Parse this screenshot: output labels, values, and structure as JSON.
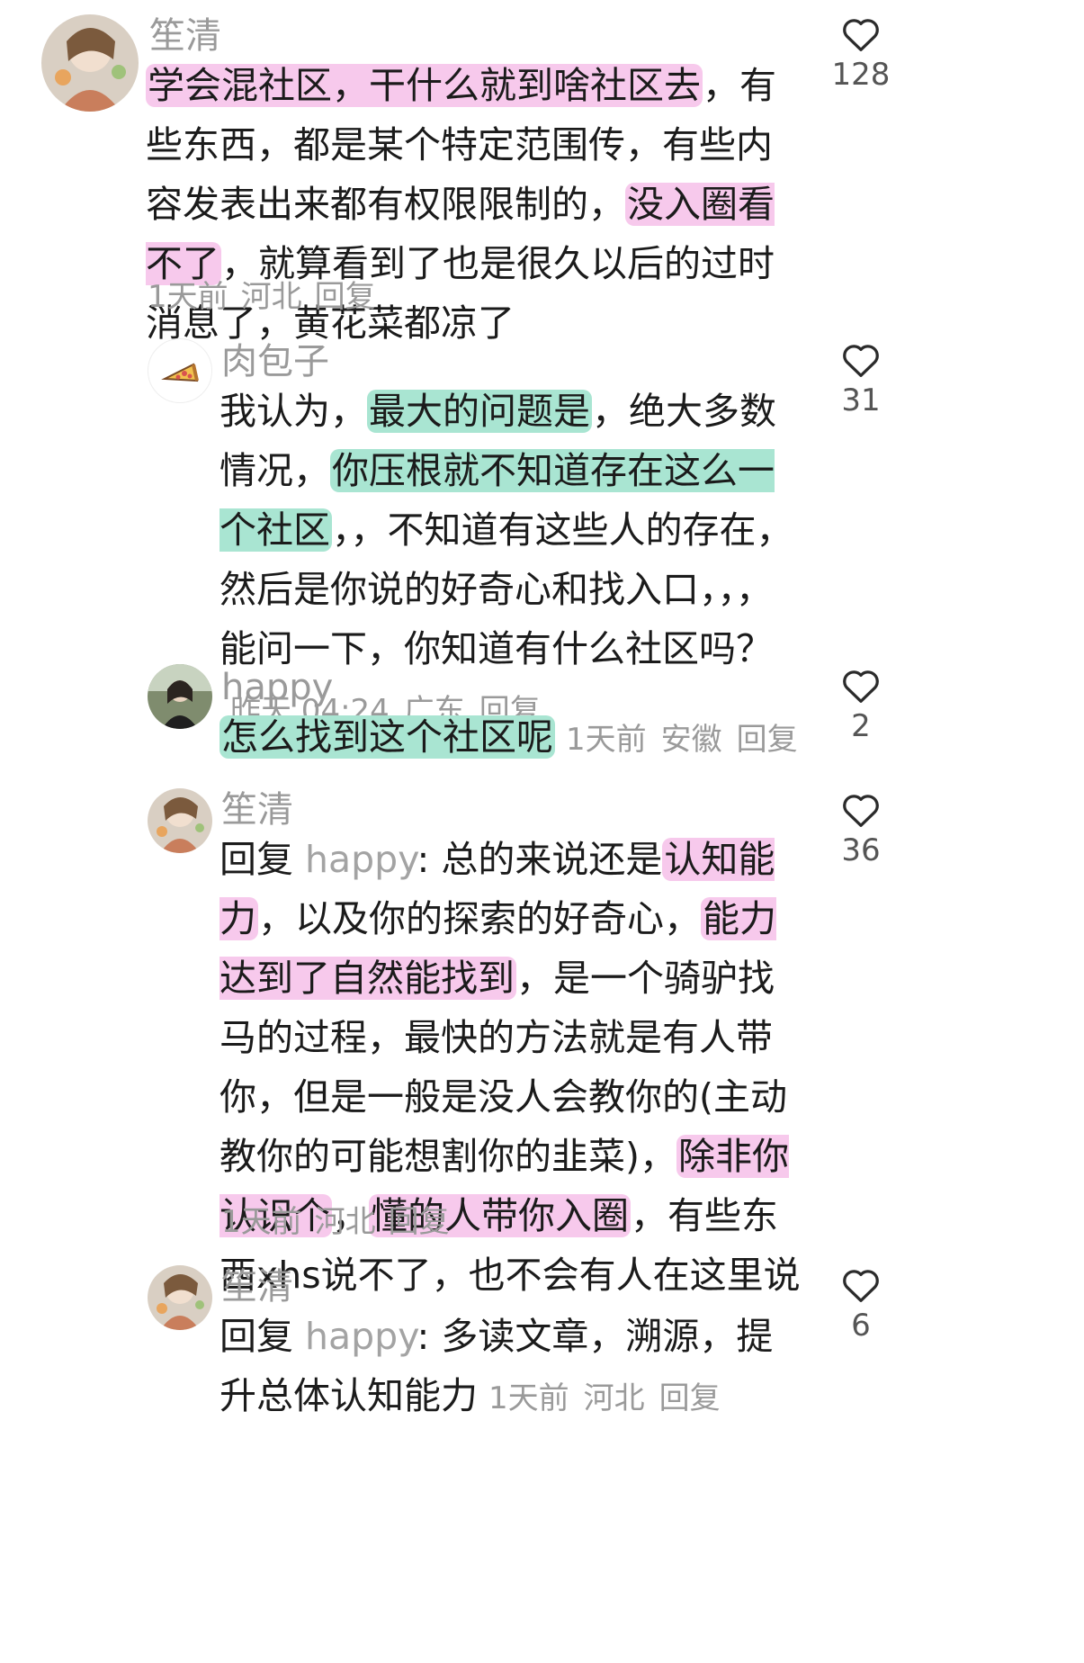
{
  "comments": [
    {
      "username": "笙清",
      "segments": [
        {
          "t": "学会混社区，干什么就到啥社区去",
          "hl": "pink"
        },
        {
          "t": "，有些东西，都是某个特定范围传，有些内容发表出来都有权限限制的，"
        },
        {
          "t": "没入圈看不了",
          "hl": "pink"
        },
        {
          "t": "，就算看到了也是很久以后的过时消息了，黄花菜都凉了"
        }
      ],
      "time": "1天前",
      "location": "河北",
      "reply_label": "回复",
      "likes": "128"
    },
    {
      "username": "肉包子",
      "segments": [
        {
          "t": "我认为，"
        },
        {
          "t": "最大的问题是",
          "hl": "green"
        },
        {
          "t": "，绝大多数情况，"
        },
        {
          "t": "你压根就不知道存在这么一个社区",
          "hl": "green"
        },
        {
          "t": "，，不知道有这些人的存在，然后是你说的好奇心和找入口，，，能问一下，你知道有什么社区吗？"
        }
      ],
      "time": "昨天 04:24",
      "location": "广东",
      "reply_label": "回复",
      "likes": "31"
    },
    {
      "username": "happy",
      "segments": [
        {
          "t": "怎么找到这个社区呢",
          "hl": "green"
        }
      ],
      "time": "1天前",
      "location": "安徽",
      "reply_label": "回复",
      "likes": "2"
    },
    {
      "username": "笙清",
      "reply_prefix": "回复 ",
      "reply_to": "happy",
      "segments": [
        {
          "t": ": 总的来说还是"
        },
        {
          "t": "认知能力",
          "hl": "pink"
        },
        {
          "t": "，以及你的探索的好奇心，"
        },
        {
          "t": "能力达到了自然能找到",
          "hl": "pink"
        },
        {
          "t": "，是一个骑驴找马的过程，最快的方法就是有人带你，但是一般是没人会教你的(主动教你的可能想割你的韭菜)，"
        },
        {
          "t": "除非你认识个",
          "hl": "pink"
        },
        {
          "t": "，"
        },
        {
          "t": "懂的人带你入圈",
          "hl": "pink"
        },
        {
          "t": "，有些东西xhs说不了，也不会有人在这里说"
        }
      ],
      "time": "1天前",
      "location": "河北",
      "reply_label": "回复",
      "likes": "36"
    },
    {
      "username": "笙清",
      "reply_prefix": "回复 ",
      "reply_to": "happy",
      "segments": [
        {
          "t": ": 多读文章，溯源，提升总体认知能力"
        }
      ],
      "time": "1天前",
      "location": "河北",
      "reply_label": "回复",
      "likes": "6"
    }
  ],
  "colors": {
    "highlight_pink": "#f7c9ec",
    "highlight_green": "#a9e5d2",
    "meta_gray": "#9a9a9a"
  },
  "icons": {
    "like": "heart-outline-icon",
    "avatar_pizza": "pizza-icon"
  }
}
